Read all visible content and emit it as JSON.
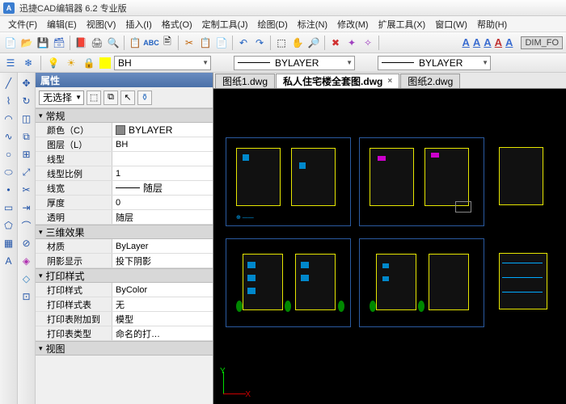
{
  "app": {
    "title": "迅捷CAD编辑器 6.2 专业版"
  },
  "menu": [
    "文件(F)",
    "编辑(E)",
    "视图(V)",
    "插入(I)",
    "格式(O)",
    "定制工具(J)",
    "绘图(D)",
    "标注(N)",
    "修改(M)",
    "扩展工具(X)",
    "窗口(W)",
    "帮助(H)"
  ],
  "toolbar2": {
    "layer_combo": "BH",
    "linetype_combo": "BYLAYER",
    "lineweight_combo": "BYLAYER"
  },
  "rt_text_labels": [
    "A",
    "A",
    "A",
    "A",
    "A"
  ],
  "rt_dim": "DIM_FO",
  "prop": {
    "title": "属性",
    "selector": "无选择",
    "sections": {
      "general": "常规",
      "effect3d": "三维效果",
      "printstyle": "打印样式",
      "view": "视图"
    },
    "rows": {
      "color": {
        "k": "颜色（C）",
        "v": "BYLAYER"
      },
      "layer": {
        "k": "图层（L）",
        "v": "BH"
      },
      "linetype": {
        "k": "线型",
        "v": ""
      },
      "ltscale": {
        "k": "线型比例",
        "v": "1"
      },
      "lineweight": {
        "k": "线宽",
        "v": "随层"
      },
      "thickness": {
        "k": "厚度",
        "v": "0"
      },
      "transparency": {
        "k": "透明",
        "v": "随层"
      },
      "material": {
        "k": "材质",
        "v": "ByLayer"
      },
      "shadow": {
        "k": "阴影显示",
        "v": "投下阴影"
      },
      "pstyle": {
        "k": "打印样式",
        "v": "ByColor"
      },
      "pstyletable": {
        "k": "打印样式表",
        "v": "无"
      },
      "pattach": {
        "k": "打印表附加到",
        "v": "模型"
      },
      "ptype": {
        "k": "打印表类型",
        "v": "命名的打…"
      }
    }
  },
  "tabs": [
    {
      "label": "图纸1.dwg",
      "active": false
    },
    {
      "label": "私人住宅楼全套图.dwg",
      "active": true
    },
    {
      "label": "图纸2.dwg",
      "active": false
    }
  ],
  "axis": {
    "y": "Y",
    "x": "X"
  }
}
